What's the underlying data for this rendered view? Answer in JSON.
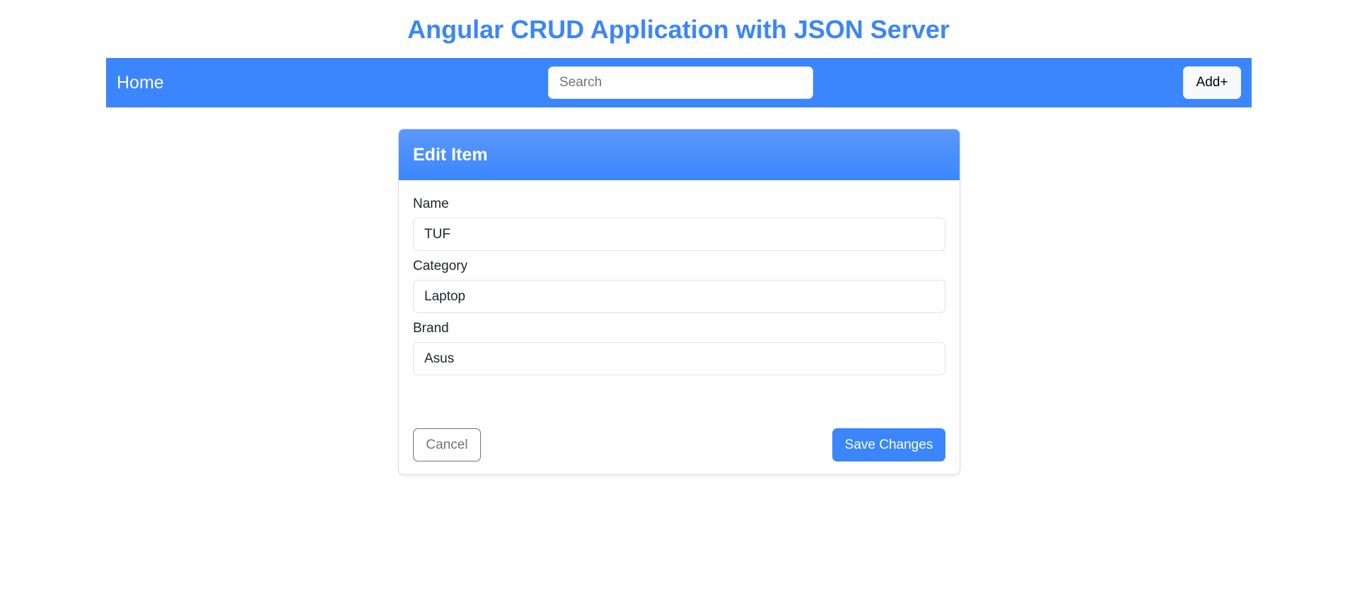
{
  "page": {
    "title": "Angular CRUD Application with JSON Server"
  },
  "navbar": {
    "home_label": "Home",
    "search_placeholder": "Search",
    "search_value": "",
    "add_label": "Add+"
  },
  "edit_card": {
    "title": "Edit Item",
    "fields": [
      {
        "label": "Name",
        "value": "TUF"
      },
      {
        "label": "Category",
        "value": "Laptop"
      },
      {
        "label": "Brand",
        "value": "Asus"
      }
    ],
    "cancel_label": "Cancel",
    "save_label": "Save Changes"
  },
  "colors": {
    "primary": "#3b86fd",
    "title_text": "#3b86f7",
    "secondary": "#6c757d"
  }
}
